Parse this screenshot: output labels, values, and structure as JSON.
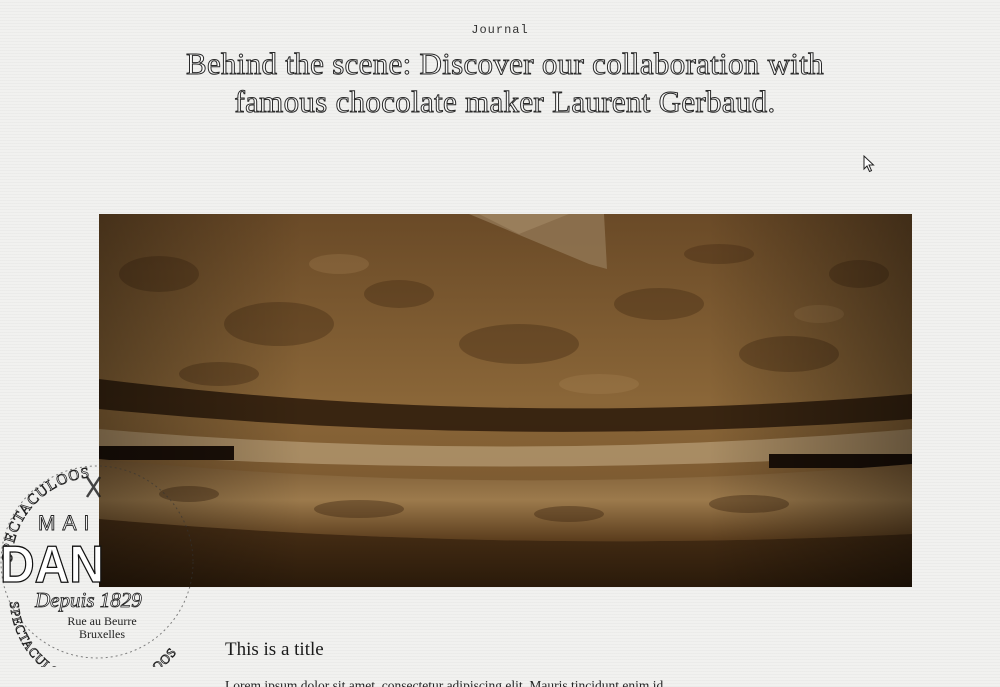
{
  "article": {
    "category": "Journal",
    "title": "Behind the scene: Discover our collaboration with famous chocolate maker Laurent Gerbaud.",
    "hero_image": "chocolate-machine-photo",
    "section_title": "This is a title",
    "body_text": "Lorem ipsum dolor sit amet, consectetur adipiscing elit. Mauris tincidunt enim id"
  },
  "stamp": {
    "arc_top": "SPECTACULOOS",
    "arc_bottom": "SPECTACULOOS SPECTACULOOS",
    "line1": "MAI",
    "line2": "DAN",
    "tagline": "Depuis 1829",
    "address1": "Rue au Beurre",
    "address2": "Bruxelles"
  },
  "colors": {
    "background": "#f1f1ef",
    "hero_tone": "#6b4a26",
    "text": "#1a1a1a"
  },
  "icons": {
    "cursor": "arrow-cursor-icon"
  }
}
